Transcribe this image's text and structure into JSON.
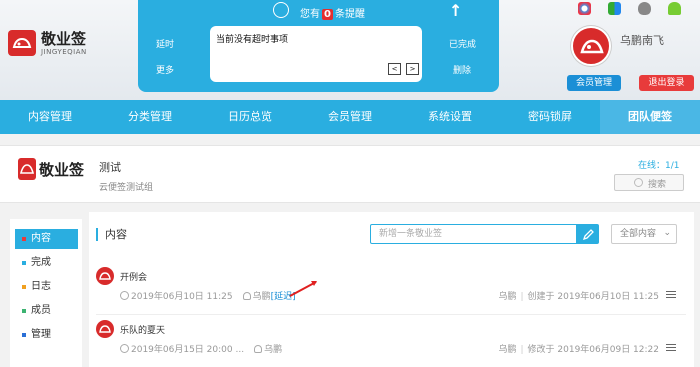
{
  "logo": {
    "name_cn": "敬业签",
    "name_en": "JINGYEQIAN"
  },
  "reminder": {
    "prefix": "您有",
    "count": "0",
    "suffix": "条提醒",
    "message": "当前没有超时事项",
    "left_top": "延时",
    "left_bottom": "更多",
    "right_top": "已完成",
    "right_bottom": "删除",
    "prev": "<",
    "next": ">"
  },
  "user": {
    "name": "乌鹏南飞",
    "vip_label": "会员管理",
    "logout_label": "退出登录"
  },
  "nav": [
    "内容管理",
    "分类管理",
    "日历总览",
    "会员管理",
    "系统设置",
    "密码锁屏",
    "团队便签"
  ],
  "team": {
    "name": "测试",
    "desc": "云便签测试组",
    "online": "在线：1/1",
    "search_placeholder": "搜索"
  },
  "sidebar": {
    "items": [
      {
        "label": "内容",
        "dot": "#e83b3b"
      },
      {
        "label": "完成",
        "dot": "#2aaee0"
      },
      {
        "label": "日志",
        "dot": "#f0a020"
      },
      {
        "label": "成员",
        "dot": "#3cb371"
      },
      {
        "label": "管理",
        "dot": "#2a6fd6"
      }
    ]
  },
  "main": {
    "title": "内容",
    "new_placeholder": "新增一条敬业签",
    "filter_label": "全部内容",
    "entries": [
      {
        "title": "开例会",
        "date": "2019年06月10日 11:25",
        "user": "乌鹏",
        "tag": "[延迟]",
        "right_user": "乌鹏",
        "right_info": "创建于 2019年06月10日 11:25"
      },
      {
        "title": "乐队的夏天",
        "date": "2019年06月15日 20:00 ...",
        "user": "乌鹏",
        "tag": "",
        "right_user": "乌鹏",
        "right_info": "修改于 2019年06月09日 12:22"
      }
    ]
  },
  "colors": {
    "accent": "#2aaee0",
    "red": "#d82b2b",
    "vip": "#1b8fd6",
    "logout": "#e83b3b"
  }
}
